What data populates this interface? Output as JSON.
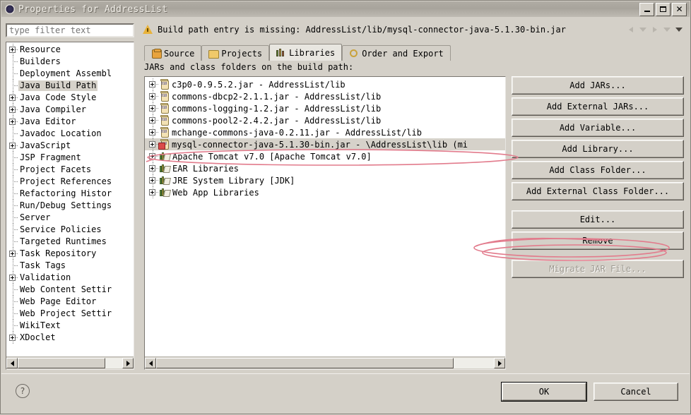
{
  "window": {
    "title": "Properties for AddressList",
    "icon": "eclipse-gear-icon",
    "minimize_label": "Minimize",
    "maximize_label": "Maximize",
    "close_label": "Close"
  },
  "filter": {
    "placeholder": "type filter text",
    "value": ""
  },
  "sidebar": {
    "items": [
      {
        "label": "Resource",
        "expandable": true
      },
      {
        "label": "Builders",
        "expandable": false
      },
      {
        "label": "Deployment Assembl",
        "expandable": false
      },
      {
        "label": "Java Build Path",
        "expandable": false,
        "selected": true
      },
      {
        "label": "Java Code Style",
        "expandable": true
      },
      {
        "label": "Java Compiler",
        "expandable": true
      },
      {
        "label": "Java Editor",
        "expandable": true
      },
      {
        "label": "Javadoc Location",
        "expandable": false
      },
      {
        "label": "JavaScript",
        "expandable": true
      },
      {
        "label": "JSP Fragment",
        "expandable": false
      },
      {
        "label": "Project Facets",
        "expandable": false
      },
      {
        "label": "Project References",
        "expandable": false
      },
      {
        "label": "Refactoring Histor",
        "expandable": false
      },
      {
        "label": "Run/Debug Settings",
        "expandable": false
      },
      {
        "label": "Server",
        "expandable": false
      },
      {
        "label": "Service Policies",
        "expandable": false
      },
      {
        "label": "Targeted Runtimes",
        "expandable": false
      },
      {
        "label": "Task Repository",
        "expandable": true
      },
      {
        "label": "Task Tags",
        "expandable": false
      },
      {
        "label": "Validation",
        "expandable": true
      },
      {
        "label": "Web Content Settir",
        "expandable": false
      },
      {
        "label": "Web Page Editor",
        "expandable": false
      },
      {
        "label": "Web Project Settir",
        "expandable": false
      },
      {
        "label": "WikiText",
        "expandable": false
      },
      {
        "label": "XDoclet",
        "expandable": true
      }
    ]
  },
  "message": {
    "icon": "warning-icon",
    "text": "Build path entry is missing: AddressList/lib/mysql-connector-java-5.1.30-bin.jar"
  },
  "nav": {
    "back": "back-arrow-icon",
    "back_menu": "back-dropdown-icon",
    "forward": "forward-arrow-icon",
    "forward_menu": "forward-dropdown-icon",
    "menu": "view-menu-icon"
  },
  "tabs": [
    {
      "label": "Source",
      "icon": "source-folder-icon",
      "active": false
    },
    {
      "label": "Projects",
      "icon": "projects-folder-icon",
      "active": false
    },
    {
      "label": "Libraries",
      "icon": "libraries-books-icon",
      "active": true
    },
    {
      "label": "Order and Export",
      "icon": "order-export-icon",
      "active": false
    }
  ],
  "main": {
    "caption": "JARs and class folders on the build path:",
    "entries": [
      {
        "label": "c3p0-0.9.5.2.jar - AddressList/lib",
        "icon": "jar-icon",
        "error": false,
        "selected": false
      },
      {
        "label": "commons-dbcp2-2.1.1.jar - AddressList/lib",
        "icon": "jar-icon",
        "error": false,
        "selected": false
      },
      {
        "label": "commons-logging-1.2.jar - AddressList/lib",
        "icon": "jar-icon",
        "error": false,
        "selected": false
      },
      {
        "label": "commons-pool2-2.4.2.jar - AddressList/lib",
        "icon": "jar-icon",
        "error": false,
        "selected": false
      },
      {
        "label": "mchange-commons-java-0.2.11.jar - AddressList/lib",
        "icon": "jar-icon",
        "error": false,
        "selected": false
      },
      {
        "label": "mysql-connector-java-5.1.30-bin.jar - \\AddressList\\lib (mi",
        "icon": "jar-error-icon",
        "error": true,
        "selected": true
      },
      {
        "label": "Apache Tomcat v7.0 [Apache Tomcat v7.0]",
        "icon": "library-icon",
        "error": false,
        "selected": false
      },
      {
        "label": "EAR Libraries",
        "icon": "library-icon",
        "error": false,
        "selected": false
      },
      {
        "label": "JRE System Library [JDK]",
        "icon": "library-icon",
        "error": false,
        "selected": false
      },
      {
        "label": "Web App Libraries",
        "icon": "library-icon",
        "error": false,
        "selected": false
      }
    ]
  },
  "buttons": [
    {
      "label": "Add JARs...",
      "name": "add-jars-button",
      "disabled": false,
      "gap": false
    },
    {
      "label": "Add External JARs...",
      "name": "add-external-jars-button",
      "disabled": false,
      "gap": false
    },
    {
      "label": "Add Variable...",
      "name": "add-variable-button",
      "disabled": false,
      "gap": false
    },
    {
      "label": "Add Library...",
      "name": "add-library-button",
      "disabled": false,
      "gap": false
    },
    {
      "label": "Add Class Folder...",
      "name": "add-class-folder-button",
      "disabled": false,
      "gap": false
    },
    {
      "label": "Add External Class Folder...",
      "name": "add-external-class-folder-button",
      "disabled": false,
      "gap": false
    },
    {
      "label": "Edit...",
      "name": "edit-button",
      "disabled": false,
      "gap": true
    },
    {
      "label": "Remove",
      "name": "remove-button",
      "disabled": false,
      "gap": false
    },
    {
      "label": "Migrate JAR File...",
      "name": "migrate-jar-file-button",
      "disabled": true,
      "gap": true
    }
  ],
  "footer": {
    "help": "?",
    "ok": "OK",
    "cancel": "Cancel"
  },
  "annotations": {
    "color": "#e27b8c",
    "remove_highlight": "ellipse around Remove button",
    "entry_highlight": "ellipse around mysql-connector entry"
  }
}
